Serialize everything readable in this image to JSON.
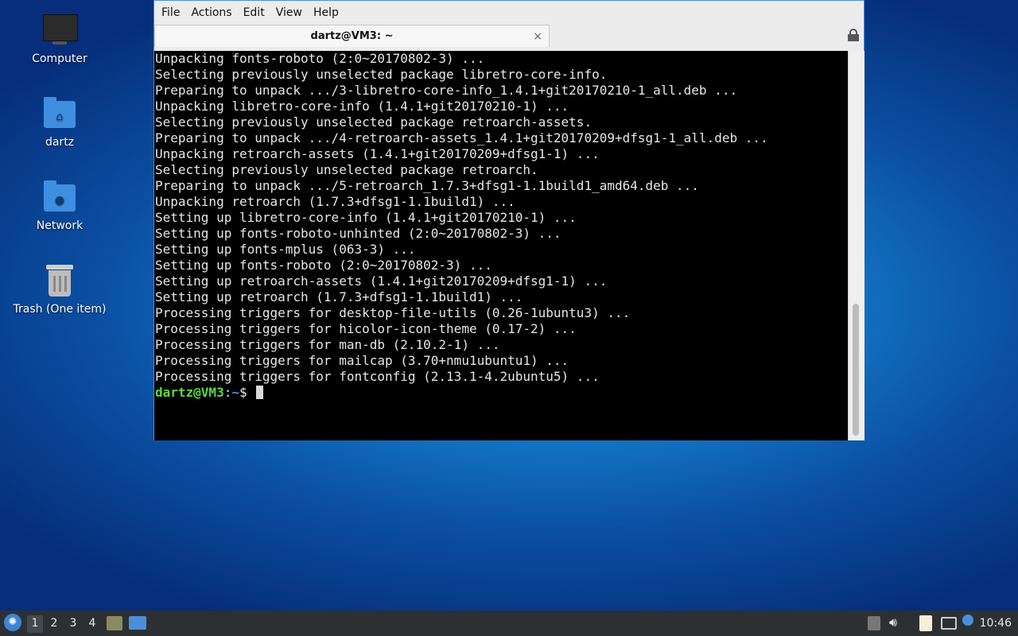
{
  "desktop": {
    "icons": [
      {
        "label": "Computer",
        "icon": "computer-icon"
      },
      {
        "label": "dartz",
        "icon": "home-folder-icon"
      },
      {
        "label": "Network",
        "icon": "network-folder-icon"
      },
      {
        "label": "Trash (One item)",
        "icon": "trash-icon"
      }
    ]
  },
  "window": {
    "menu": [
      "File",
      "Actions",
      "Edit",
      "View",
      "Help"
    ],
    "tab_title": "dartz@VM3: ~",
    "tab_close": "×"
  },
  "terminal": {
    "lines": [
      "Unpacking fonts-roboto (2:0~20170802-3) ...",
      "Selecting previously unselected package libretro-core-info.",
      "Preparing to unpack .../3-libretro-core-info_1.4.1+git20170210-1_all.deb ...",
      "Unpacking libretro-core-info (1.4.1+git20170210-1) ...",
      "Selecting previously unselected package retroarch-assets.",
      "Preparing to unpack .../4-retroarch-assets_1.4.1+git20170209+dfsg1-1_all.deb ...",
      "Unpacking retroarch-assets (1.4.1+git20170209+dfsg1-1) ...",
      "Selecting previously unselected package retroarch.",
      "Preparing to unpack .../5-retroarch_1.7.3+dfsg1-1.1build1_amd64.deb ...",
      "Unpacking retroarch (1.7.3+dfsg1-1.1build1) ...",
      "Setting up libretro-core-info (1.4.1+git20170210-1) ...",
      "Setting up fonts-roboto-unhinted (2:0~20170802-3) ...",
      "Setting up fonts-mplus (063-3) ...",
      "Setting up fonts-roboto (2:0~20170802-3) ...",
      "Setting up retroarch-assets (1.4.1+git20170209+dfsg1-1) ...",
      "Setting up retroarch (1.7.3+dfsg1-1.1build1) ...",
      "Processing triggers for desktop-file-utils (0.26-1ubuntu3) ...",
      "Processing triggers for hicolor-icon-theme (0.17-2) ...",
      "Processing triggers for man-db (2.10.2-1) ...",
      "Processing triggers for mailcap (3.70+nmu1ubuntu1) ...",
      "Processing triggers for fontconfig (2.13.1-4.2ubuntu5) ..."
    ],
    "prompt_user": "dartz@VM3",
    "prompt_sep": ":",
    "prompt_path": "~",
    "prompt_symbol": "$ "
  },
  "taskbar": {
    "workspaces": [
      "1",
      "2",
      "3",
      "4"
    ],
    "active_workspace": "1",
    "clock": "10:46"
  }
}
